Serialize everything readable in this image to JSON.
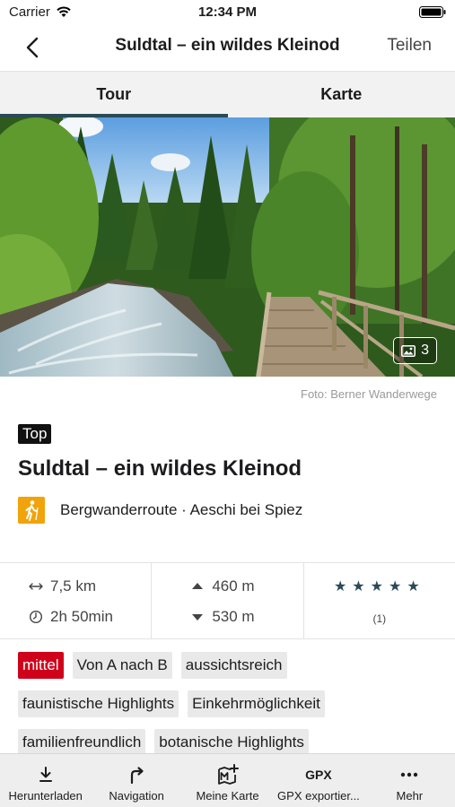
{
  "status_bar": {
    "carrier": "Carrier",
    "time": "12:34 PM"
  },
  "nav": {
    "title": "Suldtal – ein wildes Kleinod",
    "share": "Teilen"
  },
  "tabs": [
    {
      "label": "Tour",
      "active": true
    },
    {
      "label": "Karte",
      "active": false
    }
  ],
  "hero": {
    "photo_count": "3",
    "credit": "Foto: Berner Wanderwege"
  },
  "tour": {
    "badge": "Top",
    "title": "Suldtal – ein wildes Kleinod",
    "category": "Bergwanderroute · Aeschi bei Spiez",
    "category_color": "#f0a30a"
  },
  "stats": {
    "distance": "7,5 km",
    "duration": "2h 50min",
    "ascent": "460 m",
    "descent": "530 m",
    "rating_stars": 5,
    "rating_count": "(1)"
  },
  "tags": [
    {
      "label": "mittel",
      "type": "difficulty"
    },
    {
      "label": "Von A nach B"
    },
    {
      "label": "aussichtsreich"
    },
    {
      "label": "faunistische Highlights"
    },
    {
      "label": "Einkehrmöglichkeit"
    },
    {
      "label": "familienfreundlich"
    },
    {
      "label": "botanische Highlights"
    }
  ],
  "toolbar": [
    {
      "label": "Herunterladen",
      "icon": "download-icon"
    },
    {
      "label": "Navigation",
      "icon": "turn-right-icon"
    },
    {
      "label": "Meine Karte",
      "icon": "add-to-map-icon"
    },
    {
      "label": "GPX exportier...",
      "icon": "gpx-icon",
      "icon_text": "GPX"
    },
    {
      "label": "Mehr",
      "icon": "more-icon"
    }
  ],
  "colors": {
    "accent": "#2b4a55",
    "difficulty": "#d0021b",
    "badge": "#111111"
  }
}
